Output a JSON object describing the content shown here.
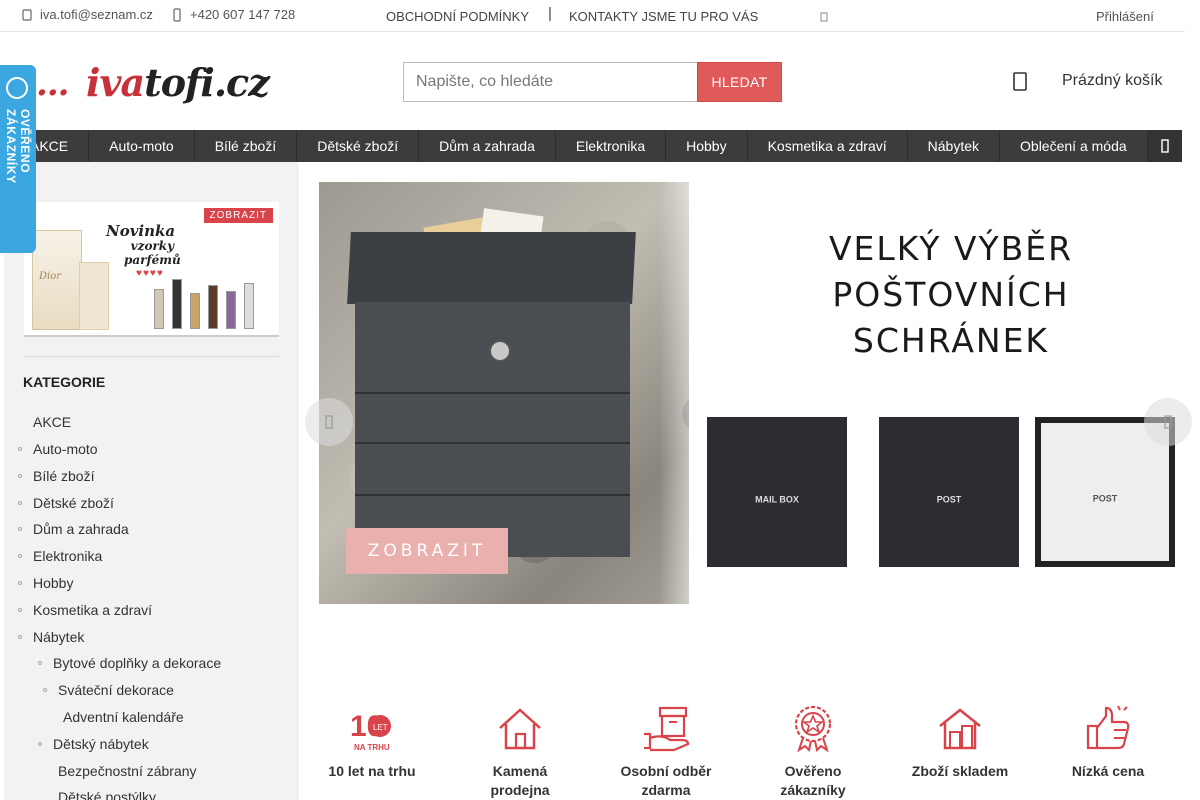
{
  "topbar": {
    "email": "iva.tofi@seznam.cz",
    "phone": "+420 607 147 728",
    "links": [
      "OBCHODNÍ PODMÍNKY",
      "KONTAKTY JSME TU PRO VÁS"
    ],
    "separator": "|",
    "login": "Přihlášení"
  },
  "logo": {
    "dots": "...",
    "part1": "iva",
    "part2": "tofi.cz"
  },
  "search": {
    "placeholder": "Napište, co hledáte",
    "button": "HLEDAT"
  },
  "cart": {
    "label": "Prázdný košík"
  },
  "nav": {
    "items": [
      "AKCE",
      "Auto-moto",
      "Bílé zboží",
      "Dětské zboží",
      "Dům a zahrada",
      "Elektronika",
      "Hobby",
      "Kosmetika a zdraví",
      "Nábytek",
      "Oblečení a móda"
    ]
  },
  "badge": {
    "text": "OVĚŘENO ZÁKAZNÍKY"
  },
  "promo": {
    "button": "ZOBRAZIT",
    "title": "Novinka",
    "subtitle_line1": "vzorky",
    "subtitle_line2": "parfémů",
    "hearts": "♥♥♥♥",
    "product": "Dior"
  },
  "sidebar": {
    "title": "KATEGORIE",
    "categories": [
      "AKCE",
      "Auto-moto",
      "Bílé zboží",
      "Dětské zboží",
      "Dům a zahrada",
      "Elektronika",
      "Hobby",
      "Kosmetika a zdraví",
      "Nábytek",
      "Bytové doplňky a dekorace",
      "Sváteční dekorace",
      "Adventní kalendáře",
      "Dětský nábytek",
      "Bezpečnostní zábrany",
      "Dětské postýlky"
    ]
  },
  "banner": {
    "headline_line1": "VELKÝ VÝBĚR",
    "headline_line2": "POŠTOVNÍCH",
    "headline_line3": "SCHRÁNEK",
    "button": "ZOBRAZIT",
    "box_labels": [
      "MAIL BOX",
      "POST",
      "POST"
    ]
  },
  "features": [
    {
      "icon": "anniversary-10-icon",
      "badge_top": "10",
      "badge_mid": "LET",
      "badge_bottom": "NA TRHU",
      "line1": "10 let na trhu",
      "line2": ""
    },
    {
      "icon": "house-icon",
      "line1": "Kamená",
      "line2": "prodejna"
    },
    {
      "icon": "box-hand-icon",
      "line1": "Osobní odběr",
      "line2": "zdarma"
    },
    {
      "icon": "star-ribbon-icon",
      "line1": "Ověřeno",
      "line2": "zákazníky"
    },
    {
      "icon": "stock-house-icon",
      "line1": "Zboží skladem",
      "line2": ""
    },
    {
      "icon": "thumbs-up-icon",
      "line1": "Nízká cena",
      "line2": ""
    }
  ],
  "colors": {
    "accent": "#e05a5a",
    "nav_bg": "#3c3c3c",
    "badge": "#3aa7e0",
    "sidebar_bg": "#f2f2f2",
    "icon": "#d9434a"
  }
}
